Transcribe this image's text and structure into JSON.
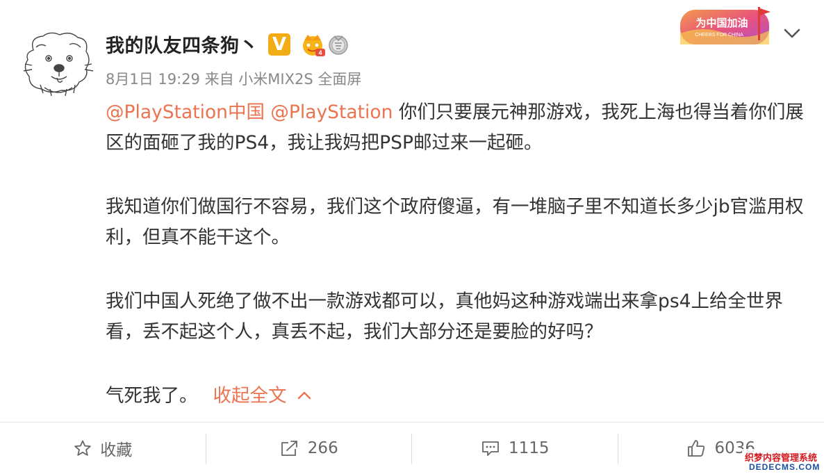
{
  "user": {
    "name": "我的队友四条狗丶",
    "badges": [
      "verified-v-icon",
      "vip-crown-icon",
      "medal-icon"
    ]
  },
  "post_meta": {
    "date": "8月1日 19:29",
    "source_prefix": "来自",
    "source_device": "小米MIX2S 全面屏"
  },
  "header_banner": {
    "title": "为中国加油",
    "subtitle": "CHEERS FOR CHINA"
  },
  "post": {
    "mention_1": "@PlayStation中国",
    "mention_2": "@PlayStation",
    "para1_rest": " 你们只要展元神那游戏，我死上海也得当着你们展区的面砸了我的PS4，我让我妈把PSP邮过来一起砸。",
    "para2": "我知道你们做国行不容易，我们这个政府傻逼，有一堆脑子里不知道长多少jb官滥用权利，但真不能干这个。",
    "para3": "我们中国人死绝了做不出一款游戏都可以，真他妈这种游戏端出来拿ps4上给全世界看，丢不起这个人，真丢不起，我们大部分还是要脸的好吗？",
    "para4": "气死我了。",
    "collapse_label": "收起全文"
  },
  "actions": {
    "favorite_label": "收藏",
    "repost_count": "266",
    "comment_count": "1115",
    "like_count": "6036"
  },
  "watermark": {
    "line1": "织梦内容管理系统",
    "line2": "DEDECMS.COM"
  },
  "colors": {
    "accent": "#eb7350",
    "text": "#333333",
    "muted": "#888888",
    "verified": "#f2ad16"
  }
}
